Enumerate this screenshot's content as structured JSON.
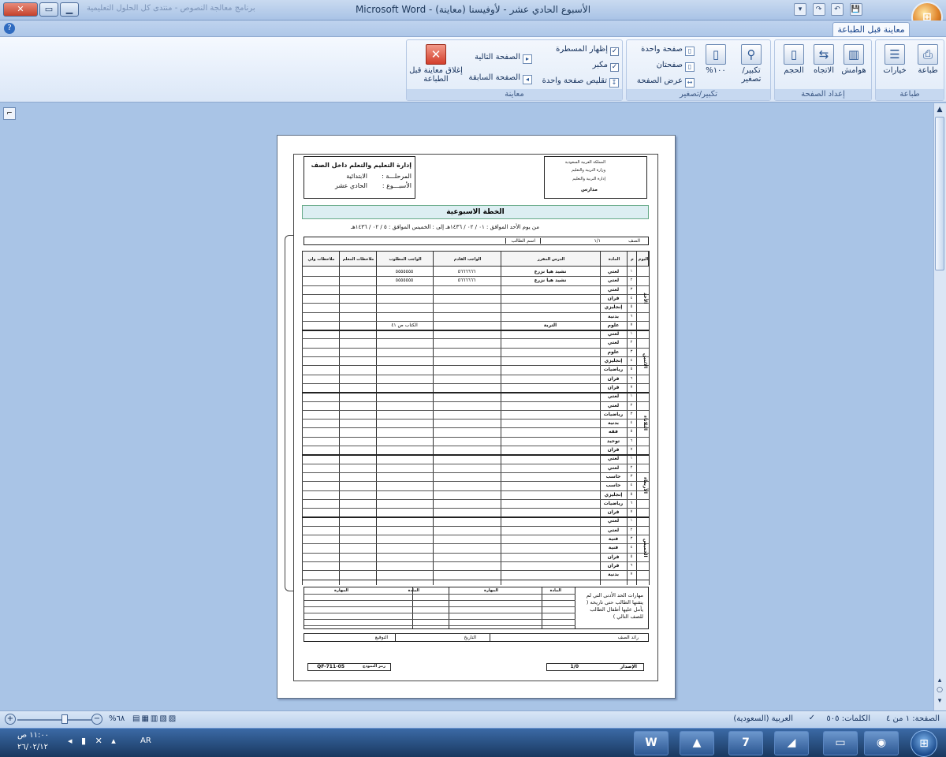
{
  "window": {
    "title": "الأسبوع الحادي عشر - لأوفيسنا (معاينة) - Microsoft Word",
    "ghost_text": "برنامج معالجة النصوص - منتدى كل الحلول التعليمية",
    "min": "▁",
    "restore": "▭",
    "close": "✕"
  },
  "qat": {
    "save": "💾",
    "undo": "↶",
    "redo": "↷",
    "more": "▾"
  },
  "ribbon": {
    "tab": "معاينة قبل الطباعة",
    "groups": {
      "print": {
        "label": "طباعة",
        "print_btn": "طباعة",
        "options_btn": "خيارات"
      },
      "page_setup": {
        "label": "إعداد الصفحة",
        "margins": "هوامش",
        "orientation": "الاتجاه",
        "size": "الحجم"
      },
      "zoom": {
        "label": "تكبير/تصغير",
        "zoom_btn": "تكبير/تصغير",
        "hundred": "١٠٠%",
        "one_page": "صفحة واحدة",
        "two_pages": "صفحتان",
        "page_width": "عرض الصفحة"
      },
      "preview": {
        "label": "معاينة",
        "show_ruler": "إظهار المسطرة",
        "magnifier": "مكبر",
        "shrink_one": "تقليص صفحة واحدة",
        "next_page": "الصفحة التالية",
        "prev_page": "الصفحة السابقة",
        "close_preview": "إغلاق معاينة قبل الطباعة"
      }
    }
  },
  "document": {
    "left_box": {
      "title": "إدارة التعليم والتعلم داخل الصف",
      "stage_label": "المرحلـــة :",
      "stage_value": "الابتدائية",
      "week_label": "الأسبـــوع :",
      "week_value": "الحادي عشر"
    },
    "right_box": {
      "line1": "المملكة العربية السعودية",
      "line2": "وزارة التربية والتعليم",
      "line3": "إدارة التربية والتعليم",
      "line4": "مدارس"
    },
    "plan_title": "الخطة الاسبوعية",
    "date_line": "من يوم الأحد الموافق : ٠١ / ٠٢ / ١٤٣٦هـ   إلى : الخميس الموافق : ٥ / ٠٢ / ١٤٣٦هـ",
    "class_label": "الصف",
    "class_value": "١/١",
    "student_label": "اسم الطالب",
    "headers": [
      "اليوم",
      "م",
      "المادة",
      "الدرس المقرر",
      "الواجب القادم",
      "الواجب المطلوب",
      "ملاحظات المعلم",
      "ملاحظات ولي الأمر"
    ],
    "days": [
      {
        "name": "الأحد",
        "subjects": [
          "لغتي",
          "لغتي",
          "لغتي",
          "قرآن",
          "إنجليزي",
          "بدنية",
          "علوم"
        ]
      },
      {
        "name": "الاثنين",
        "subjects": [
          "لغتي",
          "لغتي",
          "علوم",
          "إنجليزي",
          "رياضيات",
          "قرآن",
          "قرآن"
        ]
      },
      {
        "name": "الثلاثاء",
        "subjects": [
          "لغتي",
          "لغتي",
          "رياضيات",
          "بدنية",
          "فقه",
          "توحيد",
          "قرآن"
        ]
      },
      {
        "name": "الأربعاء",
        "subjects": [
          "لغتي",
          "لغتي",
          "حاسب",
          "حاسب",
          "إنجليزي",
          "رياضيات",
          "قرآن"
        ]
      },
      {
        "name": "الخميس",
        "subjects": [
          "لغتي",
          "لغتي",
          "فنية",
          "فنية",
          "قرآن",
          "قرآن",
          "بدنية"
        ]
      }
    ],
    "period_numbers": [
      "١",
      "٢",
      "٣",
      "٤",
      "٥",
      "٦",
      "٧"
    ],
    "cells": {
      "r1_lesson": "نشيد هيا نزرع",
      "r1_next": "٥٦٦٦٦٦٦",
      "r1_req": "٥٥٥٥٥٥٥",
      "r2_lesson": "نشيد هيا نزرع",
      "r2_next": "٥٦٦٦٦٦٦",
      "r2_req": "٥٥٥٥٥٥٥",
      "r7_lesson": "التربة",
      "r7_req": "الكتاب ص ٤١"
    },
    "skills": {
      "note": "مهارات الحد الأدنى التي لم يتقنها الطالب حتى تاريخه ( يأمل عليها أطفال الطالب للصف التالي )",
      "col_subject": "المادة",
      "col_skill": "المهارة"
    },
    "sign_row": {
      "leader": "رائد الصف",
      "date": "التاريخ",
      "signature": "التوقيع"
    },
    "footer": {
      "release_label": "الإصدار",
      "release_value": "1/0",
      "code_label": "رمز النموذج",
      "code_value": "QF-711-05"
    }
  },
  "statusbar": {
    "page": "الصفحة: ١ من ٤",
    "words": "الكلمات: ٥٠٥",
    "language": "العربية (السعودية)",
    "zoom": "%٦٨"
  },
  "taskbar": {
    "time": "١١:٠٠ ص",
    "date": "٢٦/٠٢/١٢",
    "lang": "AR"
  }
}
